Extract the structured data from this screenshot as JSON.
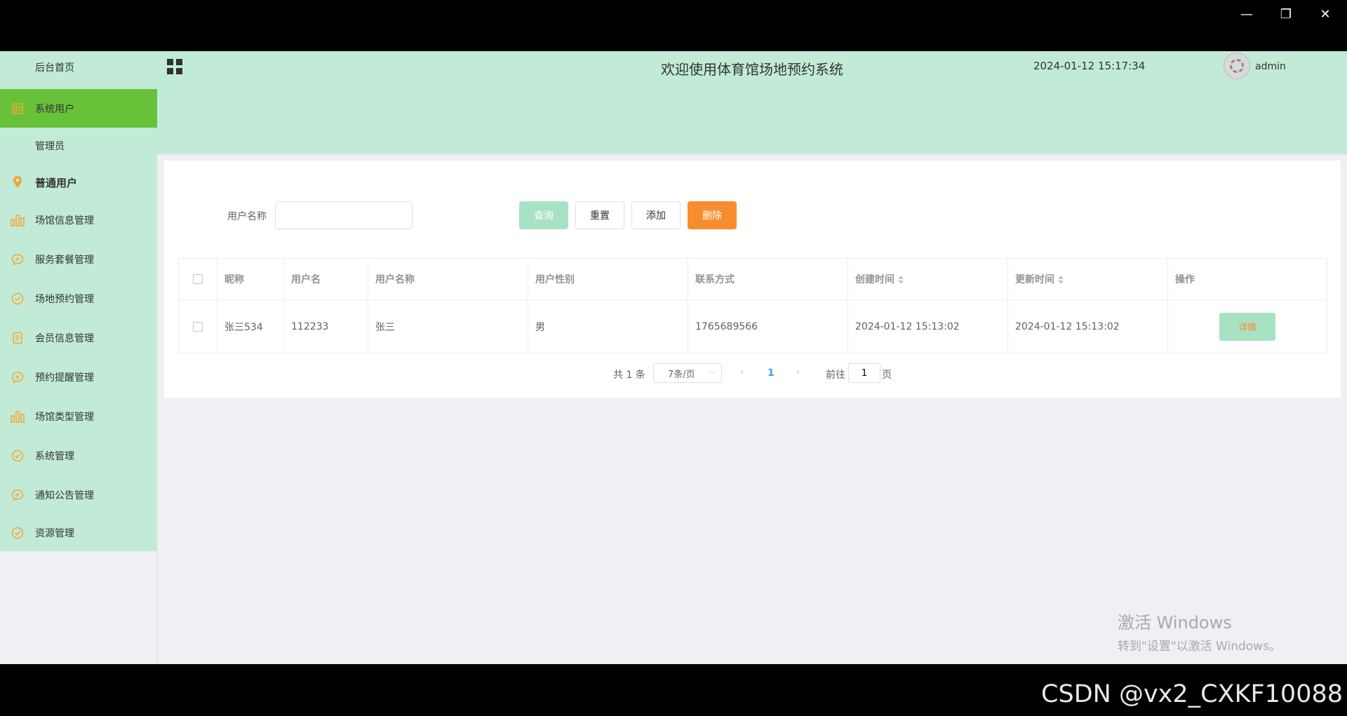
{
  "window": {
    "minimize_glyph": "—",
    "maximize_glyph": "❐",
    "close_glyph": "✕"
  },
  "sidebar": {
    "items": [
      {
        "label": "后台首页",
        "icon": "none"
      },
      {
        "label": "系统用户",
        "icon": "user-table-icon",
        "active": true
      },
      {
        "label": "管理员",
        "icon": "none"
      },
      {
        "label": "普通用户",
        "icon": "location-pin-icon"
      },
      {
        "label": "场馆信息管理",
        "icon": "bar-chart-icon"
      },
      {
        "label": "服务套餐管理",
        "icon": "chat-icon"
      },
      {
        "label": "场地预约管理",
        "icon": "check-circle-icon"
      },
      {
        "label": "会员信息管理",
        "icon": "document-icon"
      },
      {
        "label": "预约提醒管理",
        "icon": "chat-icon"
      },
      {
        "label": "场馆类型管理",
        "icon": "bar-chart-icon"
      },
      {
        "label": "系统管理",
        "icon": "check-circle-icon"
      },
      {
        "label": "通知公告管理",
        "icon": "chat-icon"
      },
      {
        "label": "资源管理",
        "icon": "check-circle-icon"
      }
    ]
  },
  "header": {
    "title": "欢迎使用体育馆场地预约系统",
    "time": "2024-01-12 15:17:34",
    "user": "admin"
  },
  "search": {
    "label": "用户名称",
    "value": "",
    "placeholder": ""
  },
  "toolbar": {
    "query": "查询",
    "reset": "重置",
    "add": "添加",
    "delete": "删除"
  },
  "table": {
    "columns": [
      "昵称",
      "用户名",
      "用户名称",
      "用户性别",
      "联系方式",
      "创建时间",
      "更新时间",
      "操作"
    ],
    "rows": [
      {
        "nickname": "张三534",
        "username": "112233",
        "name": "张三",
        "gender": "男",
        "phone": "1765689566",
        "created": "2024-01-12 15:13:02",
        "updated": "2024-01-12 15:13:02",
        "action": "详情"
      }
    ]
  },
  "pagination": {
    "total": "共 1 条",
    "page_size": "7条/页",
    "current": "1",
    "goto_prefix": "前往",
    "goto_value": "1",
    "goto_suffix": "页"
  },
  "overlay": {
    "activate_line1": "激活 Windows",
    "activate_line2": "转到\"设置\"以激活 Windows。",
    "csdn": "CSDN @vx2_CXKF10088"
  },
  "colors": {
    "sidebar_bg": "#c1ebd6",
    "active_green": "#67c23a",
    "icon_orange": "#f7a530",
    "delete_orange": "#f78d2f",
    "query_green": "#a8e2c4"
  }
}
